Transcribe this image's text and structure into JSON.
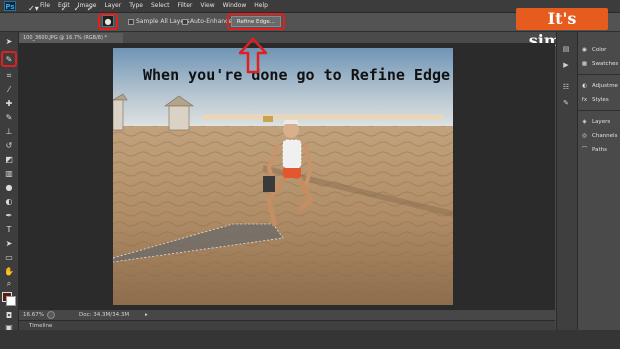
{
  "app": {
    "logo_text": "Ps",
    "menu": [
      "File",
      "Edit",
      "Image",
      "Layer",
      "Type",
      "Select",
      "Filter",
      "View",
      "Window",
      "Help"
    ]
  },
  "options_bar": {
    "tool_preset_glyph": "✓▾",
    "sample_all_layers_label": "Sample All Layers",
    "auto_enhance_label": "Auto-Enhance",
    "refine_edge_label": "Refine Edge..."
  },
  "brand": {
    "text": "It's simple!"
  },
  "document": {
    "tab_label": "100_3600.JPG @ 16.7% (RGB/8) *",
    "caption": "When you're done go to Refine Edge"
  },
  "status": {
    "zoom": "16.67%",
    "doc_info": "Doc: 34.3M/34.3M",
    "timeline_label": "Timeline"
  },
  "panels": {
    "items": [
      {
        "label": "Color",
        "icon": "color-wheel-icon"
      },
      {
        "label": "Swatches",
        "icon": "swatches-icon"
      },
      {
        "label": "Adjustme",
        "icon": "adjustments-icon"
      },
      {
        "label": "Styles",
        "icon": "styles-icon"
      },
      {
        "label": "Layers",
        "icon": "layers-icon"
      },
      {
        "label": "Channels",
        "icon": "channels-icon"
      },
      {
        "label": "Paths",
        "icon": "paths-icon"
      }
    ]
  },
  "colors": {
    "highlight": "#e02020",
    "brand": "#e65c1e",
    "foreground_swatch": "#5a1e10",
    "background_swatch": "#ffffff"
  }
}
